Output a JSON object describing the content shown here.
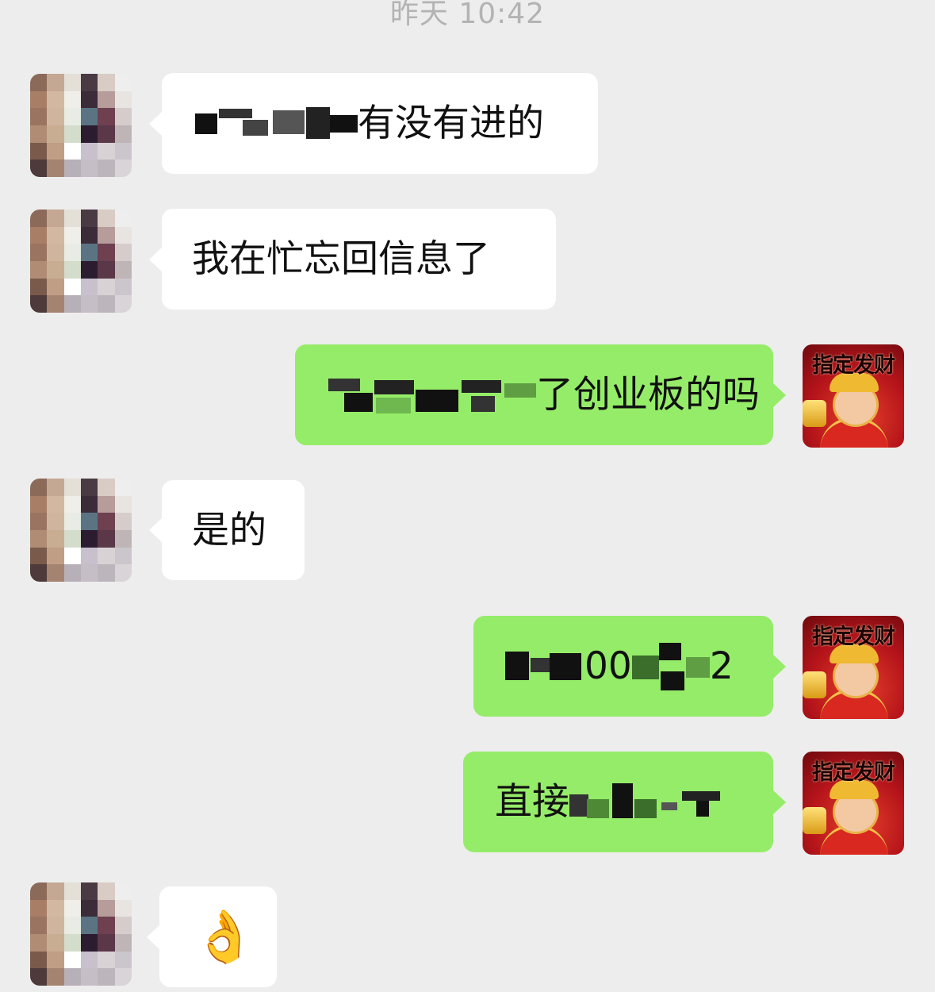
{
  "timestamp": "昨天 10:42",
  "messages": [
    {
      "side": "in",
      "visible_text": "有没有进的"
    },
    {
      "side": "in",
      "visible_text": "我在忙忘回信息了"
    },
    {
      "side": "out",
      "visible_text": "了创业板的吗"
    },
    {
      "side": "in",
      "visible_text": "是的"
    },
    {
      "side": "out",
      "visible_text": "00",
      "trailing": "2"
    },
    {
      "side": "out",
      "visible_text": "直接"
    },
    {
      "side": "in",
      "visible_text": "👌"
    }
  ],
  "self_avatar": {
    "caption": "指定发财",
    "colors": {
      "bg": "#b4141a",
      "gold": "#f0b932"
    }
  },
  "colors": {
    "background": "#ededed",
    "incoming_bubble": "#ffffff",
    "outgoing_bubble": "#95ec69"
  }
}
